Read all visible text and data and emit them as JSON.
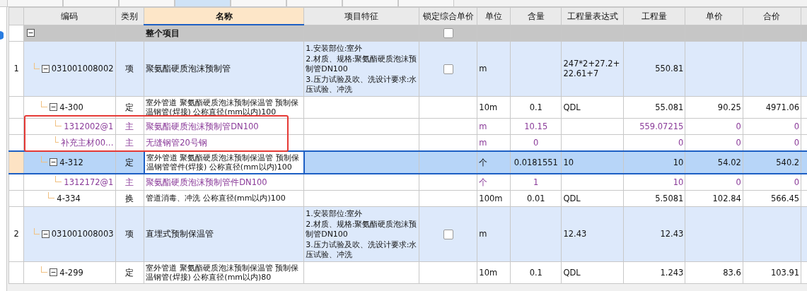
{
  "tabs": [
    {
      "selected": false
    },
    {
      "selected": false
    },
    {
      "selected": false
    },
    {
      "selected": true
    },
    {
      "selected": false
    },
    {
      "selected": false
    },
    {
      "selected": false
    },
    {
      "selected": false
    }
  ],
  "table": {
    "columns": [
      {
        "label": "编码",
        "selected": false
      },
      {
        "label": "类别",
        "selected": false
      },
      {
        "label": "名称",
        "selected": true
      },
      {
        "label": "项目特征",
        "selected": false
      },
      {
        "label": "锁定综合单价",
        "selected": false
      },
      {
        "label": "单位",
        "selected": false
      },
      {
        "label": "含量",
        "selected": false
      },
      {
        "label": "工程量表达式",
        "selected": false
      },
      {
        "label": "工程量",
        "selected": false
      },
      {
        "label": "单价",
        "selected": false
      },
      {
        "label": "合价",
        "selected": false
      },
      {
        "selected": false
      }
    ],
    "rows": [
      {
        "kind": "project",
        "name": "整个项目",
        "locked": false,
        "expanded": true,
        "selected": false,
        "children": [
          {
            "kind": "item",
            "row_number": "1",
            "code": "031001008002",
            "type": "项",
            "name": "聚氨酯硬质泡沫预制管",
            "features": "1.安装部位:室外\n2.材质、规格:聚氨酯硬质泡沫预制管DN100\n3.压力试验及吹、洗设计要求:水压试验、冲洗",
            "locked": false,
            "unit": "m",
            "expression": "247*2+27.2+22.61+7",
            "quantity": "550.81",
            "expanded": true,
            "selected": false,
            "children": [
              {
                "kind": "quota",
                "code": "4-300",
                "type": "定",
                "name": "室外管道 聚氨酯硬质泡沫预制保温管 预制保温钢管(焊接) 公称直径(mm以内)100",
                "unit": "10m",
                "ratio": "0.1",
                "expression": "QDL",
                "quantity": "55.081",
                "unit_price": "90.25",
                "total": "4971.06",
                "expanded": true,
                "selected": false,
                "children": [
                  {
                    "kind": "material",
                    "code": "1312002@1",
                    "type": "主",
                    "name": "聚氨酯硬质泡沫预制管DN100",
                    "unit": "m",
                    "ratio": "10.15",
                    "quantity": "559.07215",
                    "unit_price": "0",
                    "total": "0",
                    "selected": false
                  },
                  {
                    "kind": "material",
                    "code": "补充主材00…",
                    "type": "主",
                    "name": "无缝钢管20号钢",
                    "unit": "m",
                    "ratio": "0",
                    "quantity": "0",
                    "unit_price": "0",
                    "total": "0",
                    "selected": false
                  }
                ]
              },
              {
                "kind": "quota",
                "code": "4-312",
                "type": "定",
                "name": "室外管道 聚氨酯硬质泡沫预制保温管 预制保温钢管管件(焊接) 公称直径(mm以内)100",
                "unit": "个",
                "ratio": "0.0181551",
                "expression": "10",
                "quantity": "10",
                "unit_price": "54.02",
                "total": "540.2",
                "expanded": true,
                "selected": true,
                "children": [
                  {
                    "kind": "material",
                    "code": "1312172@1",
                    "type": "主",
                    "name": "聚氨酯硬质泡沫预制管件DN100",
                    "unit": "个",
                    "ratio": "1",
                    "quantity": "10",
                    "unit_price": "0",
                    "total": "0",
                    "selected": false
                  }
                ]
              },
              {
                "kind": "quota",
                "code": "4-334",
                "type": "换",
                "name": "管道消毒、冲洗 公称直径(mm以内)100",
                "unit": "100m",
                "ratio": "0.01",
                "expression": "QDL",
                "quantity": "5.5081",
                "unit_price": "102.84",
                "total": "566.45",
                "selected": false
              }
            ]
          },
          {
            "kind": "item",
            "row_number": "2",
            "code": "031001008003",
            "type": "项",
            "name": "直埋式预制保温管",
            "features": "1.安装部位:室外\n2.材质、规格:聚氨酯硬质泡沫预制管DN100\n3.压力试验及吹、洗设计要求:水压试验、冲洗",
            "locked": false,
            "unit": "m",
            "expression": "12.43",
            "quantity": "12.43",
            "expanded": true,
            "selected": false,
            "children": [
              {
                "kind": "quota",
                "code": "4-299",
                "type": "定",
                "name": "室外管道 聚氨酯硬质泡沫预制保温管 预制保温钢管(焊接) 公称直径(mm以内)80",
                "unit": "10m",
                "ratio": "0.1",
                "expression": "QDL",
                "quantity": "1.243",
                "unit_price": "83.6",
                "total": "103.91",
                "expanded": true,
                "selected": false
              }
            ]
          }
        ]
      }
    ]
  },
  "annotation": {
    "kind": "rectangle"
  }
}
